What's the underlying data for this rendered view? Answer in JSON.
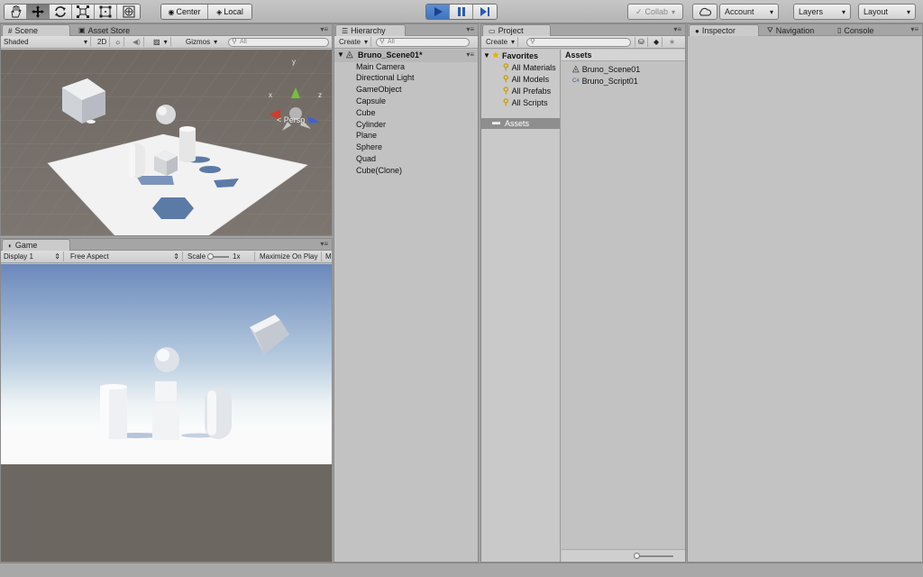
{
  "toolbar": {
    "tools": [
      "hand-tool",
      "move-tool",
      "rotate-tool",
      "scale-tool",
      "rect-tool",
      "transform-tool"
    ],
    "pivot_label": "Center",
    "space_label": "Local",
    "collab_label": "Collab",
    "account_label": "Account",
    "layers_label": "Layers",
    "layout_label": "Layout"
  },
  "scene": {
    "tab_label": "Scene",
    "asset_store_label": "Asset Store",
    "shading_mode": "Shaded",
    "mode_2d": "2D",
    "gizmos_label": "Gizmos",
    "search_placeholder": "All",
    "persp_label": "Persp",
    "axis": {
      "x": "x",
      "y": "y",
      "z": "z"
    }
  },
  "game": {
    "tab_label": "Game",
    "display": "Display 1",
    "aspect": "Free Aspect",
    "scale_label": "Scale",
    "scale_value": "1x",
    "maximize_label": "Maximize On Play",
    "more_label": "M"
  },
  "hierarchy": {
    "tab_label": "Hierarchy",
    "create_label": "Create",
    "search_placeholder": "All",
    "scene_name": "Bruno_Scene01*",
    "items": [
      "Main Camera",
      "Directional Light",
      "GameObject",
      "Capsule",
      "Cube",
      "Cylinder",
      "Plane",
      "Sphere",
      "Quad",
      "Cube(Clone)"
    ]
  },
  "project": {
    "tab_label": "Project",
    "create_label": "Create",
    "favorites_label": "Favorites",
    "favorites": [
      "All Materials",
      "All Models",
      "All Prefabs",
      "All Scripts"
    ],
    "assets_folder": "Assets",
    "assets_header": "Assets",
    "assets": [
      {
        "name": "Bruno_Scene01",
        "icon": "unity-scene-icon"
      },
      {
        "name": "Bruno_Script01",
        "icon": "csharp-script-icon"
      }
    ]
  },
  "inspector": {
    "tab_label": "Inspector",
    "navigation_label": "Navigation",
    "console_label": "Console"
  },
  "colors": {
    "play_active": "#3f74c0",
    "selection": "#8e8e8e"
  }
}
